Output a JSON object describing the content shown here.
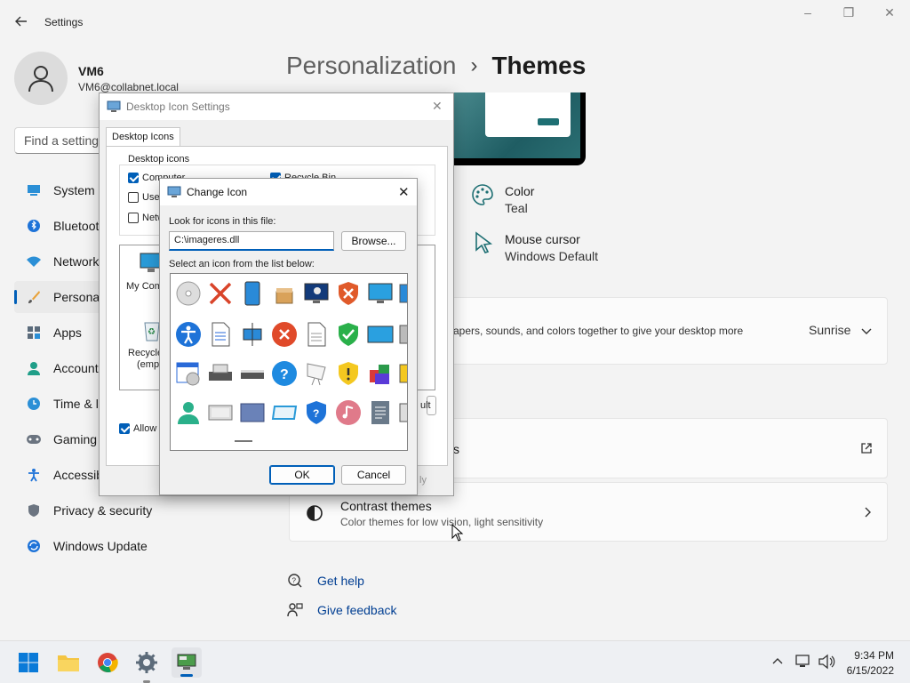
{
  "window": {
    "title": "Settings",
    "back_icon": "back-arrow-icon"
  },
  "user": {
    "name": "VM6",
    "email": "VM6@collabnet.local"
  },
  "search": {
    "placeholder": "Find a setting"
  },
  "nav": [
    {
      "label": "System",
      "icon": "system-icon"
    },
    {
      "label": "Bluetooth & devices",
      "icon": "bluetooth-icon"
    },
    {
      "label": "Network & internet",
      "icon": "network-icon"
    },
    {
      "label": "Personalization",
      "icon": "brush-icon",
      "selected": true
    },
    {
      "label": "Apps",
      "icon": "apps-icon"
    },
    {
      "label": "Accounts",
      "icon": "accounts-icon"
    },
    {
      "label": "Time & language",
      "icon": "time-icon"
    },
    {
      "label": "Gaming",
      "icon": "gaming-icon"
    },
    {
      "label": "Accessibility",
      "icon": "accessibility-icon"
    },
    {
      "label": "Privacy & security",
      "icon": "shield-icon"
    },
    {
      "label": "Windows Update",
      "icon": "update-icon"
    }
  ],
  "breadcrumb": {
    "parent": "Personalization",
    "separator": "›",
    "current": "Themes"
  },
  "theme_props": {
    "color_label": "Color",
    "color_value": "Teal",
    "cursor_label": "Mouse cursor",
    "cursor_value": "Windows Default"
  },
  "current_theme": {
    "desc": "apers, sounds, and colors together to give your desktop more",
    "value": "Sunrise"
  },
  "related": {
    "desktop_icon_settings": "s",
    "contrast_title": "Contrast themes",
    "contrast_desc": "Color themes for low vision, light sensitivity"
  },
  "help": {
    "get_help": "Get help",
    "give_feedback": "Give feedback"
  },
  "desktop_icon_dialog": {
    "title": "Desktop Icon Settings",
    "tab": "Desktop Icons",
    "group": "Desktop icons",
    "checks": [
      {
        "label": "Computer",
        "checked": true
      },
      {
        "label": "Recycle Bin",
        "checked": true
      },
      {
        "label": "User",
        "checked": false
      },
      {
        "label": "Netw",
        "checked": false
      }
    ],
    "previews": [
      {
        "label": "My Comp"
      },
      {
        "label": "Recycle"
      },
      {
        "label": "(empt"
      }
    ],
    "allow_label": "Allow t",
    "restore_default": "ult",
    "apply": "ly"
  },
  "change_icon_dialog": {
    "title": "Change Icon",
    "look_label": "Look for icons in this file:",
    "file_value": "C:\\imageres.dll",
    "browse": "Browse...",
    "select_label": "Select an icon from the list below:",
    "ok": "OK",
    "cancel": "Cancel"
  },
  "taskbar": {
    "time": "9:34 PM",
    "date": "6/15/2022"
  },
  "colors": {
    "accent": "#005fb8",
    "teal": "#1e6f73",
    "theme_dark": "#000000"
  }
}
